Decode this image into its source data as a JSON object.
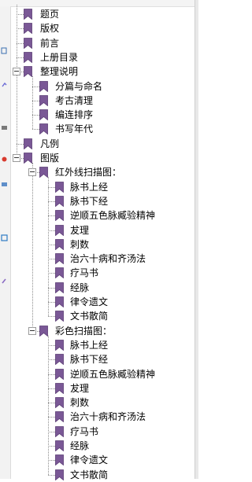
{
  "bookmarks": [
    {
      "label": "题页",
      "level": 0
    },
    {
      "label": "版权",
      "level": 0
    },
    {
      "label": "前言",
      "level": 0
    },
    {
      "label": "上册目录",
      "level": 0
    },
    {
      "label": "整理说明",
      "level": 0,
      "expanded": true
    },
    {
      "label": "分篇与命名",
      "level": 1
    },
    {
      "label": "考古清理",
      "level": 1
    },
    {
      "label": "编连排序",
      "level": 1
    },
    {
      "label": "书写年代",
      "level": 1
    },
    {
      "label": "凡例",
      "level": 0
    },
    {
      "label": "图版",
      "level": 0,
      "expanded": true
    },
    {
      "label": "红外线扫描图：",
      "level": 1,
      "expanded": true
    },
    {
      "label": "脉书上经",
      "level": 2
    },
    {
      "label": "脉书下经",
      "level": 2
    },
    {
      "label": "逆顺五色脉臧验精神",
      "level": 2
    },
    {
      "label": "犮理",
      "level": 2
    },
    {
      "label": "刺数",
      "level": 2
    },
    {
      "label": "治六十病和齐汤法",
      "level": 2
    },
    {
      "label": "疗马书",
      "level": 2
    },
    {
      "label": "经脉",
      "level": 2
    },
    {
      "label": "律令遗文",
      "level": 2
    },
    {
      "label": "文书散简",
      "level": 2
    },
    {
      "label": "彩色扫描图：",
      "level": 1,
      "expanded": true
    },
    {
      "label": "脉书上经",
      "level": 2
    },
    {
      "label": "脉书下经",
      "level": 2
    },
    {
      "label": "逆顺五色脉臧验精神",
      "level": 2
    },
    {
      "label": "犮理",
      "level": 2
    },
    {
      "label": "刺数",
      "level": 2
    },
    {
      "label": "治六十病和齐汤法",
      "level": 2
    },
    {
      "label": "疗马书",
      "level": 2
    },
    {
      "label": "经脉",
      "level": 2
    },
    {
      "label": "律令遗文",
      "level": 2
    },
    {
      "label": "文书散简",
      "level": 2
    }
  ],
  "colors": {
    "bookmark_icon": "#7a5896",
    "connector_line": "#8c8c8c"
  },
  "icons": {
    "bookmark": "bookmark-icon",
    "expander": "collapse-minus-icon"
  }
}
